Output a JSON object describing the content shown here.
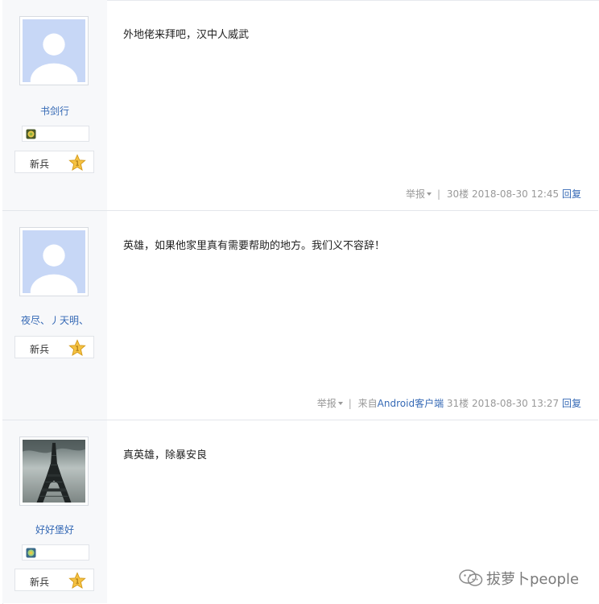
{
  "posts": [
    {
      "username": "书剑行",
      "avatar": "default-silhouette",
      "has_medal": true,
      "rank": "新兵",
      "rank_level": "1",
      "content": "外地佬来拜吧，汉中人威武",
      "report": "举报",
      "source": "",
      "floor": "30楼",
      "time": "2018-08-30 12:45",
      "reply": "回复"
    },
    {
      "username": "夜尽、丿天明、",
      "avatar": "default-silhouette",
      "has_medal": false,
      "rank": "新兵",
      "rank_level": "1",
      "content": "英雄，如果他家里真有需要帮助的地方。我们义不容辞！",
      "report": "举报",
      "source": "来自Android客户端",
      "floor": "31楼",
      "time": "2018-08-30 13:27",
      "reply": "回复"
    },
    {
      "username": "好好堡好",
      "avatar": "eiffel-tower-photo",
      "has_medal": true,
      "rank": "新兵",
      "rank_level": "1",
      "content": "真英雄，除暴安良"
    }
  ],
  "watermark": {
    "icon": "wechat-icon",
    "text": "拔萝卜people"
  },
  "colors": {
    "link": "#3569b5",
    "sidebar_bg": "#f7f8fa",
    "avatar_bg": "#c7d7f6",
    "meta": "#999999"
  }
}
